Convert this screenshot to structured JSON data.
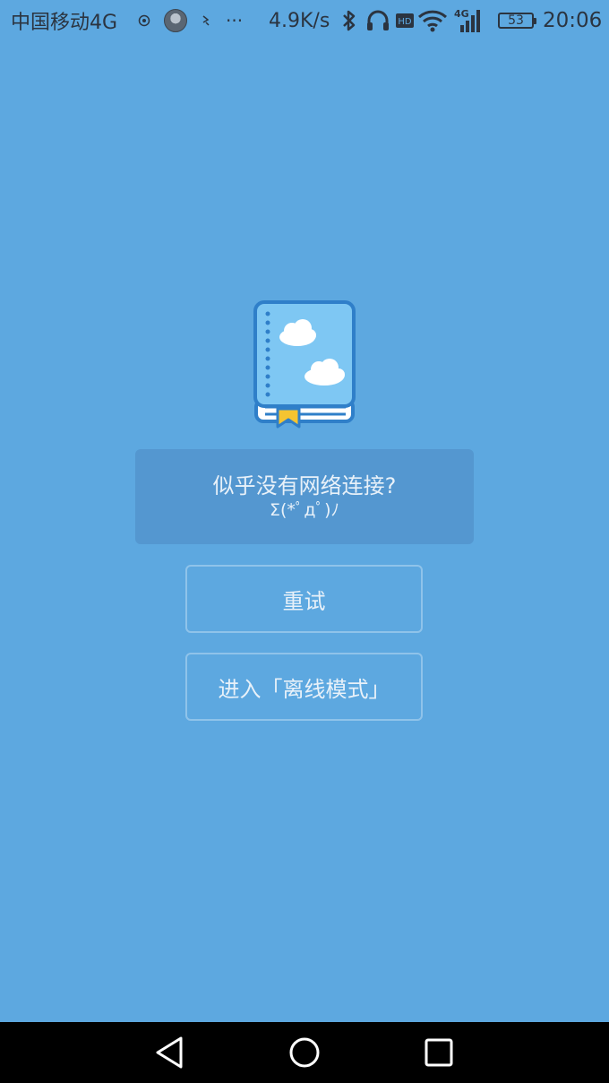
{
  "status_bar": {
    "carrier": "中国移动4G",
    "net_speed": "4.9K/s",
    "network_type": "4G",
    "hd_label": "HD",
    "battery": "53",
    "time": "20:06",
    "overflow": "···",
    "icons": [
      "location-icon",
      "avatar",
      "sync-icon",
      "more-icon",
      "bluetooth-icon",
      "headphones-icon",
      "hd-icon",
      "wifi-icon",
      "signal-icon",
      "battery-icon"
    ]
  },
  "main": {
    "icon": "book-cloud-icon",
    "message_line1": "似乎没有网络连接?",
    "message_line2": "Σ(*ﾟдﾟ)ﾉ",
    "retry_label": "重试",
    "offline_label": "进入「离线模式」"
  },
  "nav_bar": {
    "icons": [
      "back-icon",
      "home-icon",
      "recent-apps-icon"
    ]
  },
  "colors": {
    "background": "#5da8e0",
    "message_box": "#5497d0",
    "button_border": "#8fc3ea",
    "text": "#e8f1f9",
    "book_blue": "#2f7fc9",
    "book_ribbon": "#f5c431",
    "nav_bar": "#000000"
  }
}
